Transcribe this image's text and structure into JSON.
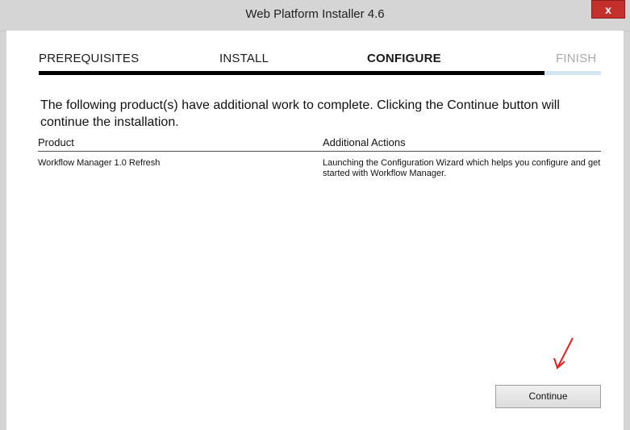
{
  "window": {
    "title": "Web Platform Installer 4.6",
    "close_label": "x"
  },
  "steps": {
    "items": [
      {
        "label": "PREREQUISITES",
        "state": "completed"
      },
      {
        "label": "INSTALL",
        "state": "completed"
      },
      {
        "label": "CONFIGURE",
        "state": "active"
      },
      {
        "label": "FINISH",
        "state": "pending"
      }
    ],
    "progress_fraction": 0.9
  },
  "main": {
    "intro": "The following product(s) have additional work to complete. Clicking the Continue button will continue the installation.",
    "table": {
      "headers": {
        "product": "Product",
        "actions": "Additional Actions"
      },
      "rows": [
        {
          "product": "Workflow Manager 1.0 Refresh",
          "action": "Launching the Configuration Wizard which helps you configure and get started with Workflow Manager."
        }
      ]
    },
    "continue_label": "Continue"
  },
  "colors": {
    "titlebar": "#d5d5d5",
    "close": "#c4302b",
    "progress": "#000000",
    "progress_track": "#d6e7f4",
    "annotation_arrow": "#e02020"
  }
}
